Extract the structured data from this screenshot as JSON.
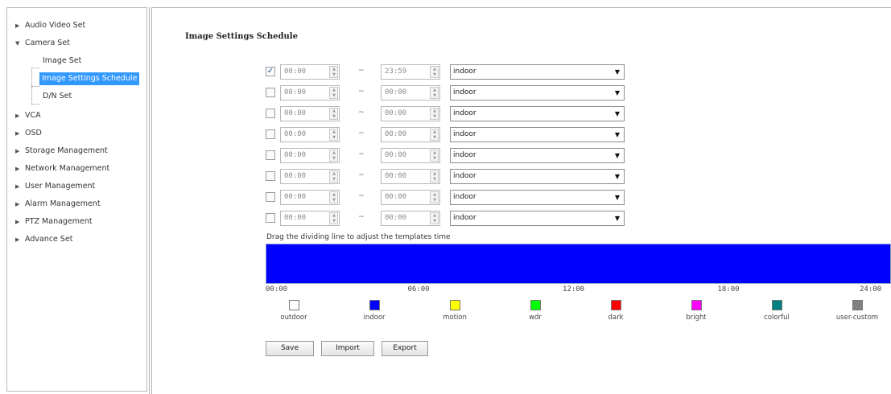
{
  "sidebar": {
    "items": [
      {
        "label": "Audio Video Set",
        "expanded": false
      },
      {
        "label": "Camera Set",
        "expanded": true,
        "children": [
          {
            "label": "Image Set",
            "selected": false
          },
          {
            "label": "Image Settings Schedule",
            "selected": true
          },
          {
            "label": "D/N Set",
            "selected": false
          }
        ]
      },
      {
        "label": "VCA",
        "expanded": false
      },
      {
        "label": "OSD",
        "expanded": false
      },
      {
        "label": "Storage Management",
        "expanded": false
      },
      {
        "label": "Network Management",
        "expanded": false
      },
      {
        "label": "User Management",
        "expanded": false
      },
      {
        "label": "Alarm Management",
        "expanded": false
      },
      {
        "label": "PTZ Management",
        "expanded": false
      },
      {
        "label": "Advance Set",
        "expanded": false
      }
    ]
  },
  "main": {
    "title": "Image Settings Schedule",
    "separator": "~",
    "rows": [
      {
        "checked": true,
        "start": "00:00",
        "end": "23:59",
        "mode": "indoor"
      },
      {
        "checked": false,
        "start": "00:00",
        "end": "00:00",
        "mode": "indoor"
      },
      {
        "checked": false,
        "start": "00:00",
        "end": "00:00",
        "mode": "indoor"
      },
      {
        "checked": false,
        "start": "00:00",
        "end": "00:00",
        "mode": "indoor"
      },
      {
        "checked": false,
        "start": "00:00",
        "end": "00:00",
        "mode": "indoor"
      },
      {
        "checked": false,
        "start": "00:00",
        "end": "00:00",
        "mode": "indoor"
      },
      {
        "checked": false,
        "start": "00:00",
        "end": "00:00",
        "mode": "indoor"
      },
      {
        "checked": false,
        "start": "00:00",
        "end": "00:00",
        "mode": "indoor"
      }
    ],
    "timeline_hint": "Drag the dividing line to adjust the templates time",
    "timeline_color": "#0000ff",
    "timeline_ticks": [
      "00:00",
      "06:00",
      "12:00",
      "18:00",
      "24:00"
    ],
    "legend": [
      {
        "label": "outdoor",
        "color": "#ffffff"
      },
      {
        "label": "indoor",
        "color": "#0000ff"
      },
      {
        "label": "motion",
        "color": "#ffff00"
      },
      {
        "label": "wdr",
        "color": "#00ff00"
      },
      {
        "label": "dark",
        "color": "#ff0000"
      },
      {
        "label": "bright",
        "color": "#ff00ff"
      },
      {
        "label": "colorful",
        "color": "#008080"
      },
      {
        "label": "user-custom",
        "color": "#808080"
      }
    ],
    "buttons": {
      "save": "Save",
      "import": "Import",
      "export": "Export"
    }
  }
}
